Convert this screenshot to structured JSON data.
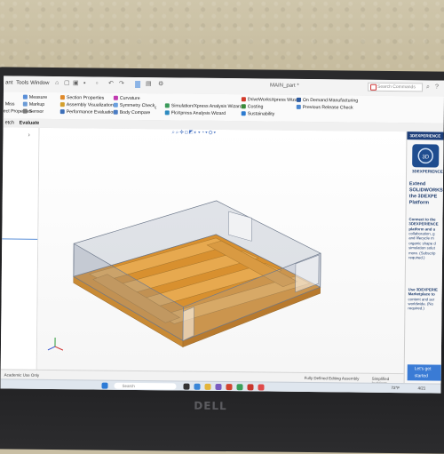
{
  "app": {
    "document_title": "MAIN_part *",
    "search_placeholder": "Search Commands"
  },
  "menu": [
    {
      "label": "ant"
    },
    {
      "label": "Tools"
    },
    {
      "label": "Window"
    }
  ],
  "command_manager": {
    "col1": [
      "Measure",
      "Markup",
      "Sensor"
    ],
    "col1_left": [
      "Miss",
      "ect Properties"
    ],
    "col2": [
      "Section Properties",
      "Assembly Visualization",
      "Performance Evaluation"
    ],
    "col3": [
      "Curvature",
      "Symmetry Check",
      "Body Compare"
    ],
    "col4": [
      "Simulation/Xpress Analysis Wizard",
      "FloXpress Analysis Wizard"
    ],
    "col5": [
      "DriveWorksXpress Wizard",
      "Costing",
      "Sustainability"
    ],
    "col6": [
      "On Demand Manufacturing",
      "Previous Release Check"
    ]
  },
  "tabs": [
    {
      "label": "etch"
    },
    {
      "label": "Evaluate",
      "active": true
    }
  ],
  "task_pane": {
    "header": "3DEXPERIENCE",
    "brand": "3DEXPERIENCE",
    "heading": [
      "Extend",
      "SOLIDWORKS",
      "the 3DEXPE",
      "Platform"
    ],
    "para1": [
      "Connect to the",
      "3DEXPERIENCE",
      "platform and u",
      "collaboration, g",
      "and lifecycle m",
      "organic shape d",
      "simulation solut",
      "more. (Subscrip",
      "required.)"
    ],
    "para2": [
      "Use 3DEXPERIE",
      "Marketplace to",
      "content and ser",
      "worldwide. (No",
      "required.)"
    ],
    "button": [
      "Let's get",
      "started"
    ]
  },
  "status_bar": {
    "left": "Academic Use Only",
    "right1": "Fully Defined  Editing Assembly",
    "right2": "Simplified Inch/mm"
  },
  "taskbar": {
    "search": "Search",
    "weather": "72°F",
    "clock": "4/21"
  },
  "device": {
    "brand": "DELL"
  }
}
